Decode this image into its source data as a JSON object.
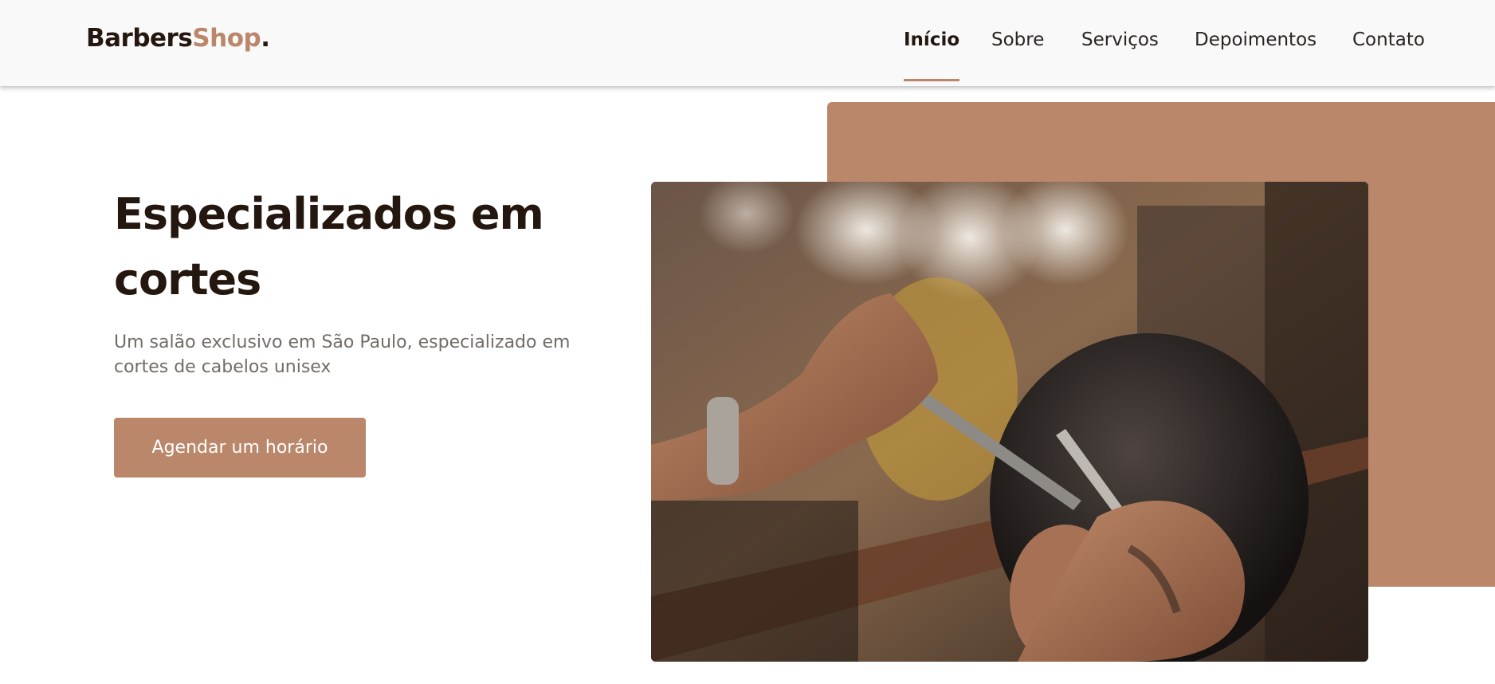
{
  "brand": {
    "name_part1": "Barbers",
    "name_part2": "Shop",
    "name_dot": ".",
    "accent_color": "#bb876b",
    "dark_color": "#24170f"
  },
  "nav": {
    "items": [
      {
        "label": "Início",
        "active": true
      },
      {
        "label": "Sobre",
        "active": false
      },
      {
        "label": "Serviços",
        "active": false
      },
      {
        "label": "Depoimentos",
        "active": false
      },
      {
        "label": "Contato",
        "active": false
      }
    ]
  },
  "hero": {
    "title": "Especializados em cortes",
    "subtitle": "Um salão exclusivo em São Paulo, especializado em cortes de cabelos unisex",
    "cta_label": "Agendar um horário",
    "image_icon": "barber-cutting-hair-photo"
  }
}
